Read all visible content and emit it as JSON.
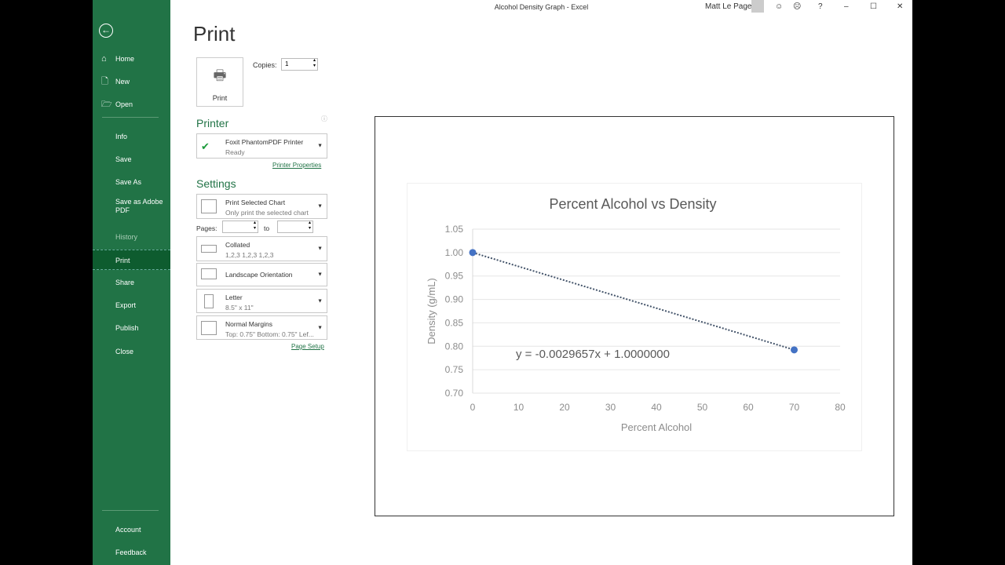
{
  "window": {
    "title": "Alcohol Density Graph  -  Excel",
    "user": "Matt Le Page"
  },
  "sidebar": {
    "items": [
      {
        "label": "Home",
        "icon": "home-icon"
      },
      {
        "label": "New",
        "icon": "new-icon"
      },
      {
        "label": "Open",
        "icon": "open-icon"
      },
      {
        "label": "Info"
      },
      {
        "label": "Save"
      },
      {
        "label": "Save As"
      },
      {
        "label": "Save as Adobe PDF"
      },
      {
        "label": "History"
      },
      {
        "label": "Print"
      },
      {
        "label": "Share"
      },
      {
        "label": "Export"
      },
      {
        "label": "Publish"
      },
      {
        "label": "Close"
      },
      {
        "label": "Account"
      },
      {
        "label": "Feedback"
      }
    ]
  },
  "print": {
    "heading": "Print",
    "button": "Print",
    "copies_label": "Copies:",
    "copies": "1",
    "printer_heading": "Printer",
    "printer_name": "Foxit PhantomPDF Printer",
    "printer_status": "Ready",
    "printer_properties": "Printer Properties",
    "settings_heading": "Settings",
    "settings": [
      {
        "t1": "Print Selected Chart",
        "t2": "Only print the selected chart"
      },
      {
        "t1": "Collated",
        "t2": "1,2,3    1,2,3    1,2,3"
      },
      {
        "t1": "Landscape Orientation",
        "t2": ""
      },
      {
        "t1": "Letter",
        "t2": "8.5\" x 11\""
      },
      {
        "t1": "Normal Margins",
        "t2": "Top: 0.75\" Bottom: 0.75\" Lef..."
      }
    ],
    "pages_label": "Pages:",
    "to_label": "to",
    "page_setup": "Page Setup"
  },
  "chart_data": {
    "type": "scatter",
    "title": "Percent Alcohol vs Density",
    "xlabel": "Percent Alcohol",
    "ylabel": "Density (g/mL)",
    "xlim": [
      0,
      80
    ],
    "ylim": [
      0.7,
      1.05
    ],
    "xticks": [
      "0",
      "10",
      "20",
      "30",
      "40",
      "50",
      "60",
      "70",
      "80"
    ],
    "yticks": [
      "0.70",
      "0.75",
      "0.80",
      "0.85",
      "0.90",
      "0.95",
      "1.00",
      "1.05"
    ],
    "points": [
      {
        "x": 0,
        "y": 1.0
      },
      {
        "x": 70,
        "y": 0.7924
      }
    ],
    "trendline": {
      "slope": -0.0029657,
      "intercept": 1.0,
      "style": "dotted",
      "label": "y = -0.0029657x + 1.0000000"
    },
    "grid": true,
    "color": "#4472c4"
  }
}
